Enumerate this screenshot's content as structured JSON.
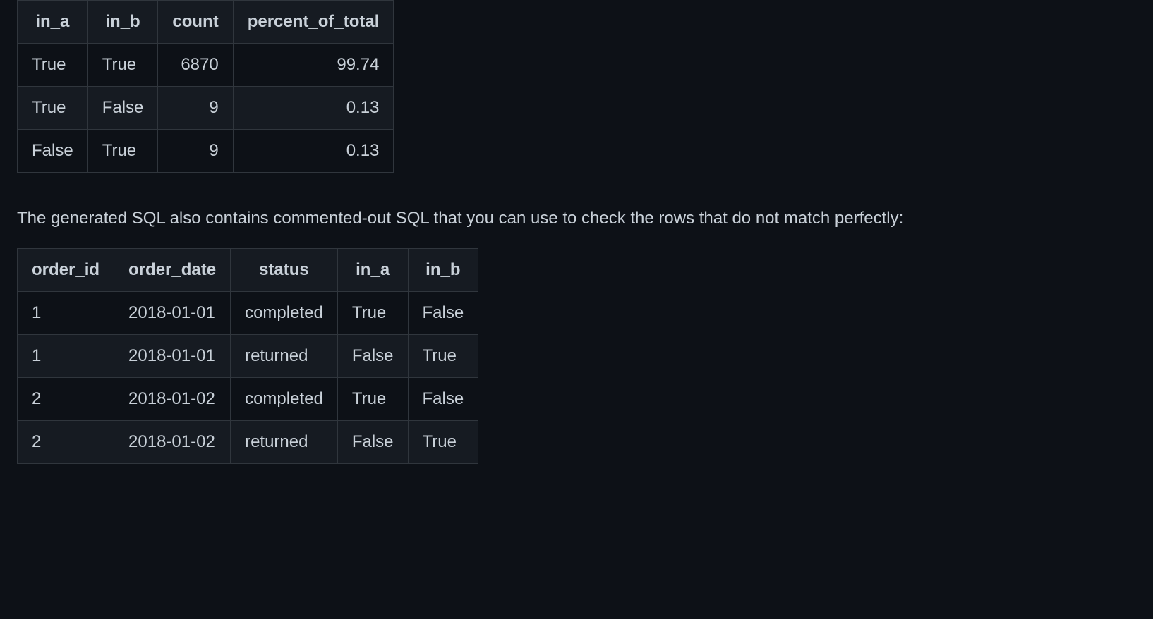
{
  "table1": {
    "headers": [
      "in_a",
      "in_b",
      "count",
      "percent_of_total"
    ],
    "rows": [
      {
        "in_a": "True",
        "in_b": "True",
        "count": "6870",
        "percent_of_total": "99.74"
      },
      {
        "in_a": "True",
        "in_b": "False",
        "count": "9",
        "percent_of_total": "0.13"
      },
      {
        "in_a": "False",
        "in_b": "True",
        "count": "9",
        "percent_of_total": "0.13"
      }
    ]
  },
  "paragraph": "The generated SQL also contains commented-out SQL that you can use to check the rows that do not match perfectly:",
  "table2": {
    "headers": [
      "order_id",
      "order_date",
      "status",
      "in_a",
      "in_b"
    ],
    "rows": [
      {
        "order_id": "1",
        "order_date": "2018-01-01",
        "status": "completed",
        "in_a": "True",
        "in_b": "False"
      },
      {
        "order_id": "1",
        "order_date": "2018-01-01",
        "status": "returned",
        "in_a": "False",
        "in_b": "True"
      },
      {
        "order_id": "2",
        "order_date": "2018-01-02",
        "status": "completed",
        "in_a": "True",
        "in_b": "False"
      },
      {
        "order_id": "2",
        "order_date": "2018-01-02",
        "status": "returned",
        "in_a": "False",
        "in_b": "True"
      }
    ]
  }
}
